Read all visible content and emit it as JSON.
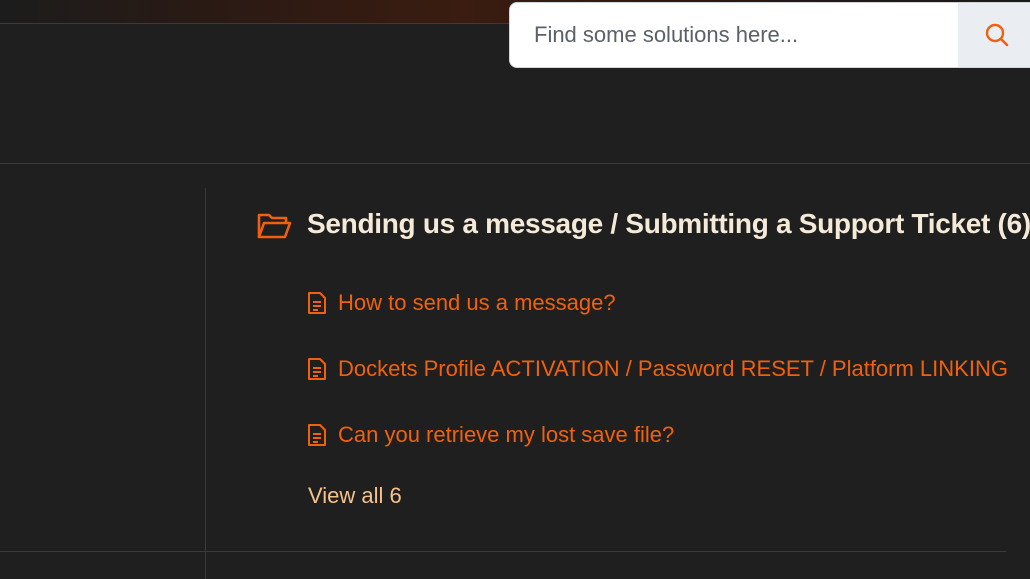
{
  "search": {
    "placeholder": "Find some solutions here...",
    "value": ""
  },
  "icons": {
    "search": "search-icon",
    "folder": "folder-open-icon",
    "article": "document-icon"
  },
  "colors": {
    "background": "#1f1f1f",
    "accent": "#f0610f",
    "title": "#f5ead7",
    "view_all": "#f5c28e"
  },
  "section": {
    "title": "Sending us a message / Submitting a Support Ticket (6)",
    "articles": [
      {
        "label": "How to send us a message?"
      },
      {
        "label": "Dockets Profile ACTIVATION / Password RESET / Platform LINKING"
      },
      {
        "label": "Can you retrieve my lost save file?"
      }
    ],
    "view_all_label": "View all 6"
  }
}
